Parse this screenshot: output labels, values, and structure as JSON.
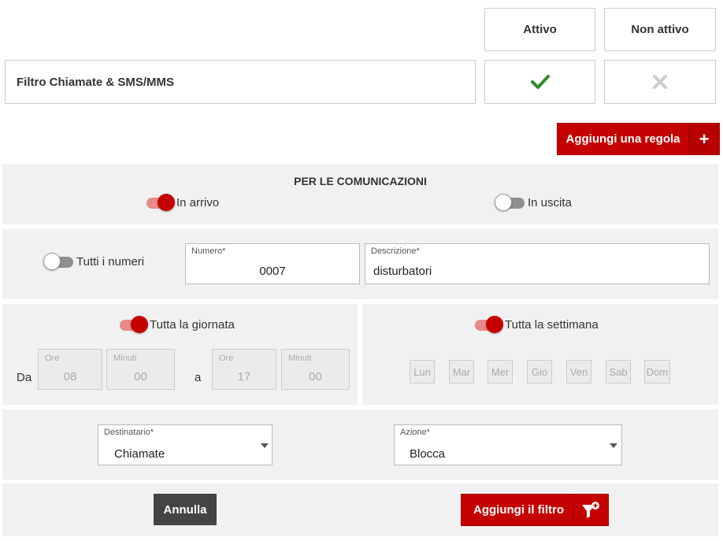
{
  "columns": {
    "active": "Attivo",
    "inactive": "Non attivo"
  },
  "filter": {
    "name": "Filtro Chiamate & SMS/MMS",
    "status": "Attivo"
  },
  "add_rule_button": "Aggiungi una regola",
  "communications": {
    "title": "PER LE COMUNICAZIONI",
    "incoming": {
      "label": "In arrivo",
      "on": true
    },
    "outgoing": {
      "label": "In uscita",
      "on": false
    }
  },
  "numbers": {
    "all_numbers": {
      "label": "Tutti i numeri",
      "on": false
    },
    "number": {
      "label": "Numero*",
      "value": "0007"
    },
    "description": {
      "label": "Descrizione*",
      "value": "disturbatori"
    }
  },
  "time": {
    "all_day": {
      "label": "Tutta la giornata",
      "on": true
    },
    "from_label": "Da",
    "to_label": "a",
    "from": {
      "hours_label": "Ore",
      "hours": "08",
      "minutes_label": "Minuti",
      "minutes": "00"
    },
    "to": {
      "hours_label": "Ore",
      "hours": "17",
      "minutes_label": "Minuti",
      "minutes": "00"
    }
  },
  "week": {
    "all_week": {
      "label": "Tutta la settimana",
      "on": true
    },
    "days": [
      "Lun",
      "Mar",
      "Mer",
      "Gio",
      "Ven",
      "Sab",
      "Dom"
    ]
  },
  "recipient": {
    "label": "Destinatario*",
    "value": "Chiamate"
  },
  "action": {
    "label": "Azione*",
    "value": "Blocca"
  },
  "cancel_button": "Annulla",
  "add_filter_button": "Aggiungi il filtro",
  "colors": {
    "brand_red": "#c50000",
    "check_green": "#2e8b2e",
    "disabled_x": "#cccccc",
    "panel_bg": "#f1f1f1",
    "dark_button": "#444444"
  }
}
